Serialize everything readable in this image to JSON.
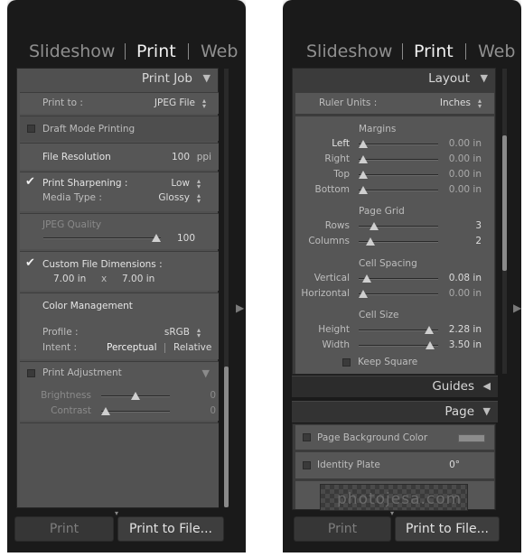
{
  "left_panel": {
    "modules": [
      "Slideshow",
      "Print",
      "Web"
    ],
    "section_title": "Print Job",
    "print_to": {
      "label": "Print to :",
      "value": "JPEG File"
    },
    "draft_mode": {
      "label": "Draft Mode Printing",
      "checked": false
    },
    "file_resolution": {
      "label": "File Resolution",
      "value": "100",
      "unit": "ppi"
    },
    "print_sharpening": {
      "label": "Print Sharpening :",
      "value": "Low",
      "checked": true
    },
    "media_type": {
      "label": "Media Type :",
      "value": "Glossy"
    },
    "jpeg_quality": {
      "label": "JPEG Quality",
      "value": "100",
      "fraction": 1.0
    },
    "custom_dimensions": {
      "label": "Custom File Dimensions :",
      "width": "7.00 in",
      "x": "x",
      "height": "7.00 in",
      "checked": true
    },
    "color_management": {
      "title": "Color Management",
      "profile_label": "Profile :",
      "profile_value": "sRGB",
      "intent_label": "Intent :",
      "intent_options": [
        "Perceptual",
        "Relative"
      ],
      "intent_selected": "Perceptual"
    },
    "print_adjustment": {
      "label": "Print Adjustment",
      "checked": false,
      "brightness": {
        "label": "Brightness",
        "value": "0",
        "fraction": 0.5
      },
      "contrast": {
        "label": "Contrast",
        "value": "0",
        "fraction": 0.0
      }
    },
    "buttons": {
      "print": "Print",
      "print_to_file": "Print to File..."
    }
  },
  "right_panel": {
    "modules": [
      "Slideshow",
      "Print",
      "Web"
    ],
    "section_title": "Layout",
    "ruler_units": {
      "label": "Ruler Units :",
      "value": "Inches"
    },
    "margins": {
      "title": "Margins",
      "rows": [
        {
          "label": "Left",
          "value": "0.00 in",
          "fraction": 0.0
        },
        {
          "label": "Right",
          "value": "0.00 in",
          "fraction": 0.0
        },
        {
          "label": "Top",
          "value": "0.00 in",
          "fraction": 0.0
        },
        {
          "label": "Bottom",
          "value": "0.00 in",
          "fraction": 0.0
        }
      ]
    },
    "page_grid": {
      "title": "Page Grid",
      "rows": [
        {
          "label": "Rows",
          "value": "3",
          "fraction": 0.15
        },
        {
          "label": "Columns",
          "value": "2",
          "fraction": 0.1
        }
      ]
    },
    "cell_spacing": {
      "title": "Cell Spacing",
      "rows": [
        {
          "label": "Vertical",
          "value": "0.08 in",
          "fraction": 0.05
        },
        {
          "label": "Horizontal",
          "value": "0.00 in",
          "fraction": 0.0
        }
      ]
    },
    "cell_size": {
      "title": "Cell Size",
      "rows": [
        {
          "label": "Height",
          "value": "2.28 in",
          "fraction": 0.93
        },
        {
          "label": "Width",
          "value": "3.50 in",
          "fraction": 0.95
        }
      ]
    },
    "keep_square": {
      "label": "Keep Square",
      "checked": false
    },
    "guides_title": "Guides",
    "page_title": "Page",
    "page_background": {
      "label": "Page Background Color",
      "checked": false
    },
    "identity_plate": {
      "label": "Identity Plate",
      "value": "0°",
      "checked": false,
      "logo_text": "photojesa.com"
    },
    "buttons": {
      "print": "Print",
      "print_to_file": "Print to File..."
    }
  }
}
